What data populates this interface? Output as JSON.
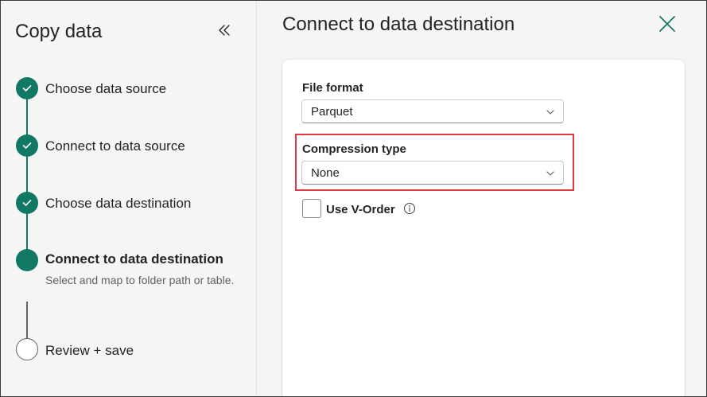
{
  "sidebar": {
    "title": "Copy data",
    "collapse_icon": "double-chevron-left-icon",
    "steps": [
      {
        "label": "Choose data source",
        "state": "done"
      },
      {
        "label": "Connect to data source",
        "state": "done"
      },
      {
        "label": "Choose data destination",
        "state": "done"
      },
      {
        "label": "Connect to data destination",
        "state": "current",
        "description": "Select and map to folder path or table."
      },
      {
        "label": "Review + save",
        "state": "todo"
      }
    ]
  },
  "main": {
    "title": "Connect to data destination",
    "close_icon": "close-icon",
    "file_format": {
      "label": "File format",
      "value": "Parquet"
    },
    "compression_type": {
      "label": "Compression type",
      "value": "None"
    },
    "v_order": {
      "label": "Use V-Order",
      "checked": false,
      "info_icon": "info-icon"
    }
  },
  "colors": {
    "accent": "#117865",
    "highlight_border": "#e0393e",
    "sidebar_bg": "#f5f5f5",
    "card_bg": "#ffffff"
  }
}
